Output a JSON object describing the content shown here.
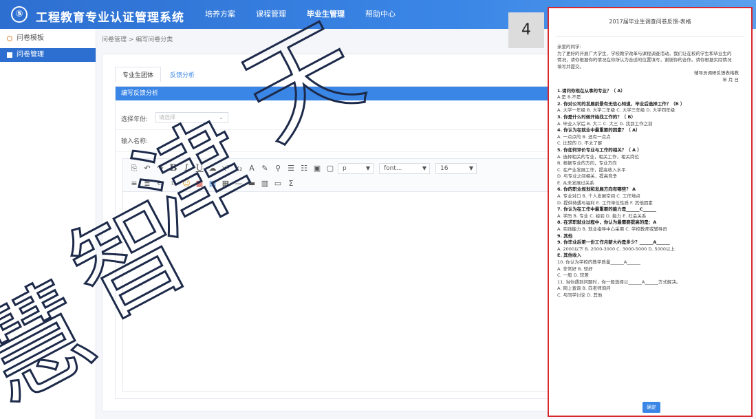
{
  "app": {
    "logo_glyph": "⑤",
    "title": "工程教育专业认证管理系统"
  },
  "topnav": [
    "培养方案",
    "课程管理",
    "毕业生管理",
    "帮助中心"
  ],
  "sidebar": {
    "items": [
      {
        "label": "问卷模板",
        "icon": "circle-icon"
      },
      {
        "label": "问卷管理",
        "icon": "grid-icon",
        "active": true
      }
    ]
  },
  "breadcrumb": "问卷管理 > 编写问卷分类",
  "tabs": [
    "专业生团体",
    "反馈分析"
  ],
  "panel": {
    "title": "编写反馈分析",
    "year_label": "选择年份:",
    "year_placeholder": "请选择",
    "name_label": "输入名称:"
  },
  "editor": {
    "toolbar_row1": [
      "↶",
      "↷",
      "⎘",
      "B",
      "I",
      "U",
      "☁",
      "x²",
      "x₂",
      "A",
      "✎",
      "⚲",
      "☰",
      "☷",
      "▣",
      "▢"
    ],
    "toolbar_row2": [
      "≡",
      "≣",
      "⇔",
      "⌗",
      "☺",
      "▩",
      "▤",
      "▦",
      "—",
      "▬",
      "▥",
      "▭",
      "Σ"
    ],
    "paragraph_select": "p",
    "font_select": "font...",
    "size_select": "16"
  },
  "step_badge": "4",
  "doc": {
    "title": "2017届毕业生调查问卷反馈-表格",
    "lines": [
      {
        "t": "亲爱的同学:"
      },
      {
        "t": "为了更好的开展广大学生、学校教学改革与课程调查活动，我们让在校的学生和毕业生的"
      },
      {
        "t": "情况，请你根据你的情况在你所认为合适的位置填写，谢谢你的合作。请你根据实际情况"
      },
      {
        "t": "填写并提交。"
      },
      {
        "t": "辅导员调研反馈表格教",
        "right": true
      },
      {
        "t": "年    月    日",
        "right": true
      },
      {
        "gap": true
      },
      {
        "t": "1.请问你现在从事的专业？（ A）",
        "b": true
      },
      {
        "t": "  A.是        B.不是"
      },
      {
        "t": "2. 你对公司的发展前景有无信心知道，毕业后选择工作？（B ）",
        "b": true
      },
      {
        "t": "  A. 大学一年级    B. 大学二年级    C. 大学三年级    D. 大学四年级"
      },
      {
        "t": "3. 你是什么时候开始找工作的？（ B）",
        "b": true
      },
      {
        "t": "  A. 毕业入学后    B. 大二    C. 大三    D. 找到工作之前"
      },
      {
        "t": "4. 你认为在就业中最重要的因素？（    A）",
        "b": true
      },
      {
        "t": "  A. 一点点的    B. 还有一点点"
      },
      {
        "t": "  C. 比较的    D. 不太了解"
      },
      {
        "t": "5. 你如何评价专业与工作的相关？（    A ）",
        "b": true
      },
      {
        "t": "  A. 选择相关的专业，相关工作，相关岗位"
      },
      {
        "t": "  B. 根据专业的方向，专业方向"
      },
      {
        "t": "  C. 在产业发展工作，提高收入水平"
      },
      {
        "t": "  D. 与专业之间相关，提高竞争"
      },
      {
        "t": "  E. 从未发展过关系"
      },
      {
        "t": "6. 你的职业规划和发展方向有哪些？    A",
        "b": true
      },
      {
        "t": "  A. 专业对口    B. 个人发展空间    C. 工作地点"
      },
      {
        "t": "  D. 提供待遇与福利    E. 工作单位性质    F. 其他因素"
      },
      {
        "t": "7. 你认为在工作中最重要的能力是______C______",
        "b": true
      },
      {
        "t": "  A. 学历    B. 专业    C. 经验    D. 能力    E. 社会关系"
      },
      {
        "t": "8. 在求职就业过程中，你认为最需要提高的是：A",
        "b": true
      },
      {
        "t": "  A. 实践能力    B. 就业指导中心采用    C. 学校教师或辅导员"
      },
      {
        "t": "9. 其他",
        "b": true
      },
      {
        "t": "9. 你毕业后第一份工作月薪大约是多少？______A______",
        "b": true
      },
      {
        "t": "  A. 2000以下    B. 2000-3000    C. 3000-5000    D. 5000以上"
      },
      {
        "t": "E. 其他收入",
        "b": true
      },
      {
        "t": "10. 你认为学校的教学质量______A______"
      },
      {
        "t": "  A. 非常好    B. 较好"
      },
      {
        "t": "  C. 一般    D. 较差"
      },
      {
        "t": "11. 当你遇到问题时，你一般选择以______A______方式解决。"
      },
      {
        "t": "  A. 网上查询    B. 向老师询问"
      },
      {
        "t": "  C. 与同学讨论    D. 其他"
      }
    ],
    "submit_label": "确定"
  },
  "watermark": [
    "天",
    "津",
    "智",
    "慧"
  ]
}
